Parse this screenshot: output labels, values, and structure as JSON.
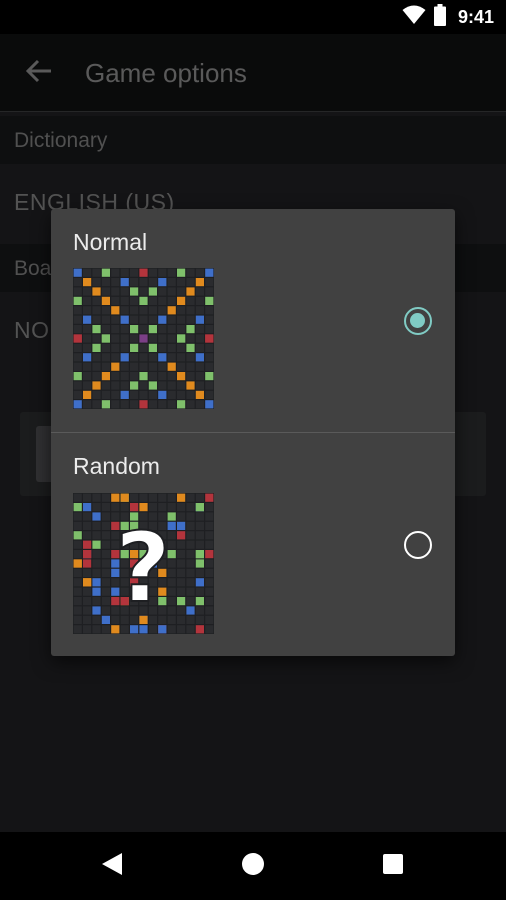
{
  "status_bar": {
    "time": "9:41",
    "icons": [
      "wifi-icon",
      "battery-icon"
    ]
  },
  "app_bar": {
    "title": "Game options",
    "back_icon": "arrow-left-icon"
  },
  "settings": {
    "dictionary": {
      "header": "Dictionary",
      "value": "ENGLISH (US)"
    },
    "board": {
      "header": "Boa",
      "value": "NO"
    }
  },
  "dialog": {
    "options": [
      {
        "label": "Normal",
        "selected": true,
        "board_icon": "normal-board-icon"
      },
      {
        "label": "Random",
        "selected": false,
        "board_icon": "random-board-icon",
        "overlay_glyph": "?"
      }
    ]
  },
  "colors": {
    "accent": "#80cbc4",
    "board_bg": "#2a2b2e",
    "tile_blue": "#3f6fc9",
    "tile_orange": "#e08a1e",
    "tile_green": "#7fc06b",
    "tile_red": "#b3343c",
    "tile_purple": "#7b3f86"
  },
  "nav_bar": {
    "icons": [
      "back-triangle-icon",
      "home-circle-icon",
      "recents-square-icon"
    ]
  }
}
